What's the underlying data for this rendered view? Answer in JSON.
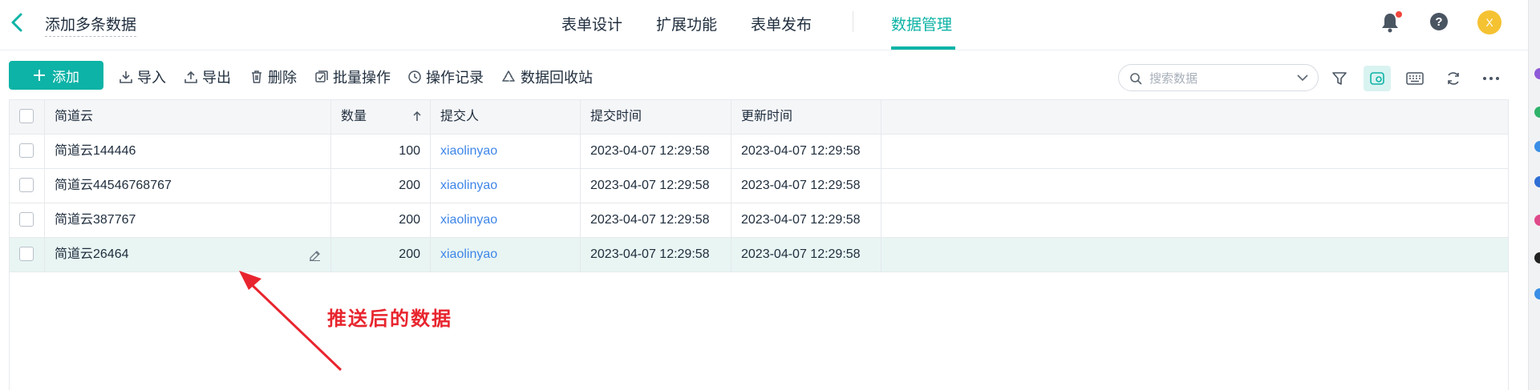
{
  "header": {
    "form_title": "添加多条数据",
    "tabs": [
      {
        "label": "表单设计"
      },
      {
        "label": "扩展功能"
      },
      {
        "label": "表单发布"
      },
      {
        "label": "数据管理"
      }
    ],
    "active_tab": "数据管理",
    "avatar_initial": "X"
  },
  "toolbar": {
    "add_label": "添加",
    "import_label": "导入",
    "export_label": "导出",
    "delete_label": "删除",
    "batch_label": "批量操作",
    "log_label": "操作记录",
    "recycle_label": "数据回收站"
  },
  "search": {
    "placeholder": "搜索数据",
    "value": ""
  },
  "table": {
    "columns": [
      "简道云",
      "数量",
      "提交人",
      "提交时间",
      "更新时间"
    ],
    "sorted_column": "数量",
    "rows": [
      {
        "name": "简道云144446",
        "qty": "100",
        "submitter": "xiaolinyao",
        "submit_time": "2023-04-07 12:29:58",
        "update_time": "2023-04-07 12:29:58"
      },
      {
        "name": "简道云44546768767",
        "qty": "200",
        "submitter": "xiaolinyao",
        "submit_time": "2023-04-07 12:29:58",
        "update_time": "2023-04-07 12:29:58"
      },
      {
        "name": "简道云387767",
        "qty": "200",
        "submitter": "xiaolinyao",
        "submit_time": "2023-04-07 12:29:58",
        "update_time": "2023-04-07 12:29:58"
      },
      {
        "name": "简道云26464",
        "qty": "200",
        "submitter": "xiaolinyao",
        "submit_time": "2023-04-07 12:29:58",
        "update_time": "2023-04-07 12:29:58"
      }
    ]
  },
  "annotation": {
    "text": "推送后的数据"
  },
  "icons": {
    "back": "chevron-left-icon",
    "bell": "bell-icon",
    "help": "question-icon",
    "filter": "filter-icon",
    "view": "card-view-icon",
    "keyboard": "keyboard-icon",
    "refresh": "refresh-icon",
    "more": "more-icon",
    "search": "search-icon"
  },
  "colors": {
    "accent": "#0db3a6",
    "link": "#3f86e8",
    "annotation": "#e8252e",
    "avatar": "#f5c232",
    "highlight_row": "#e8f5f3"
  }
}
